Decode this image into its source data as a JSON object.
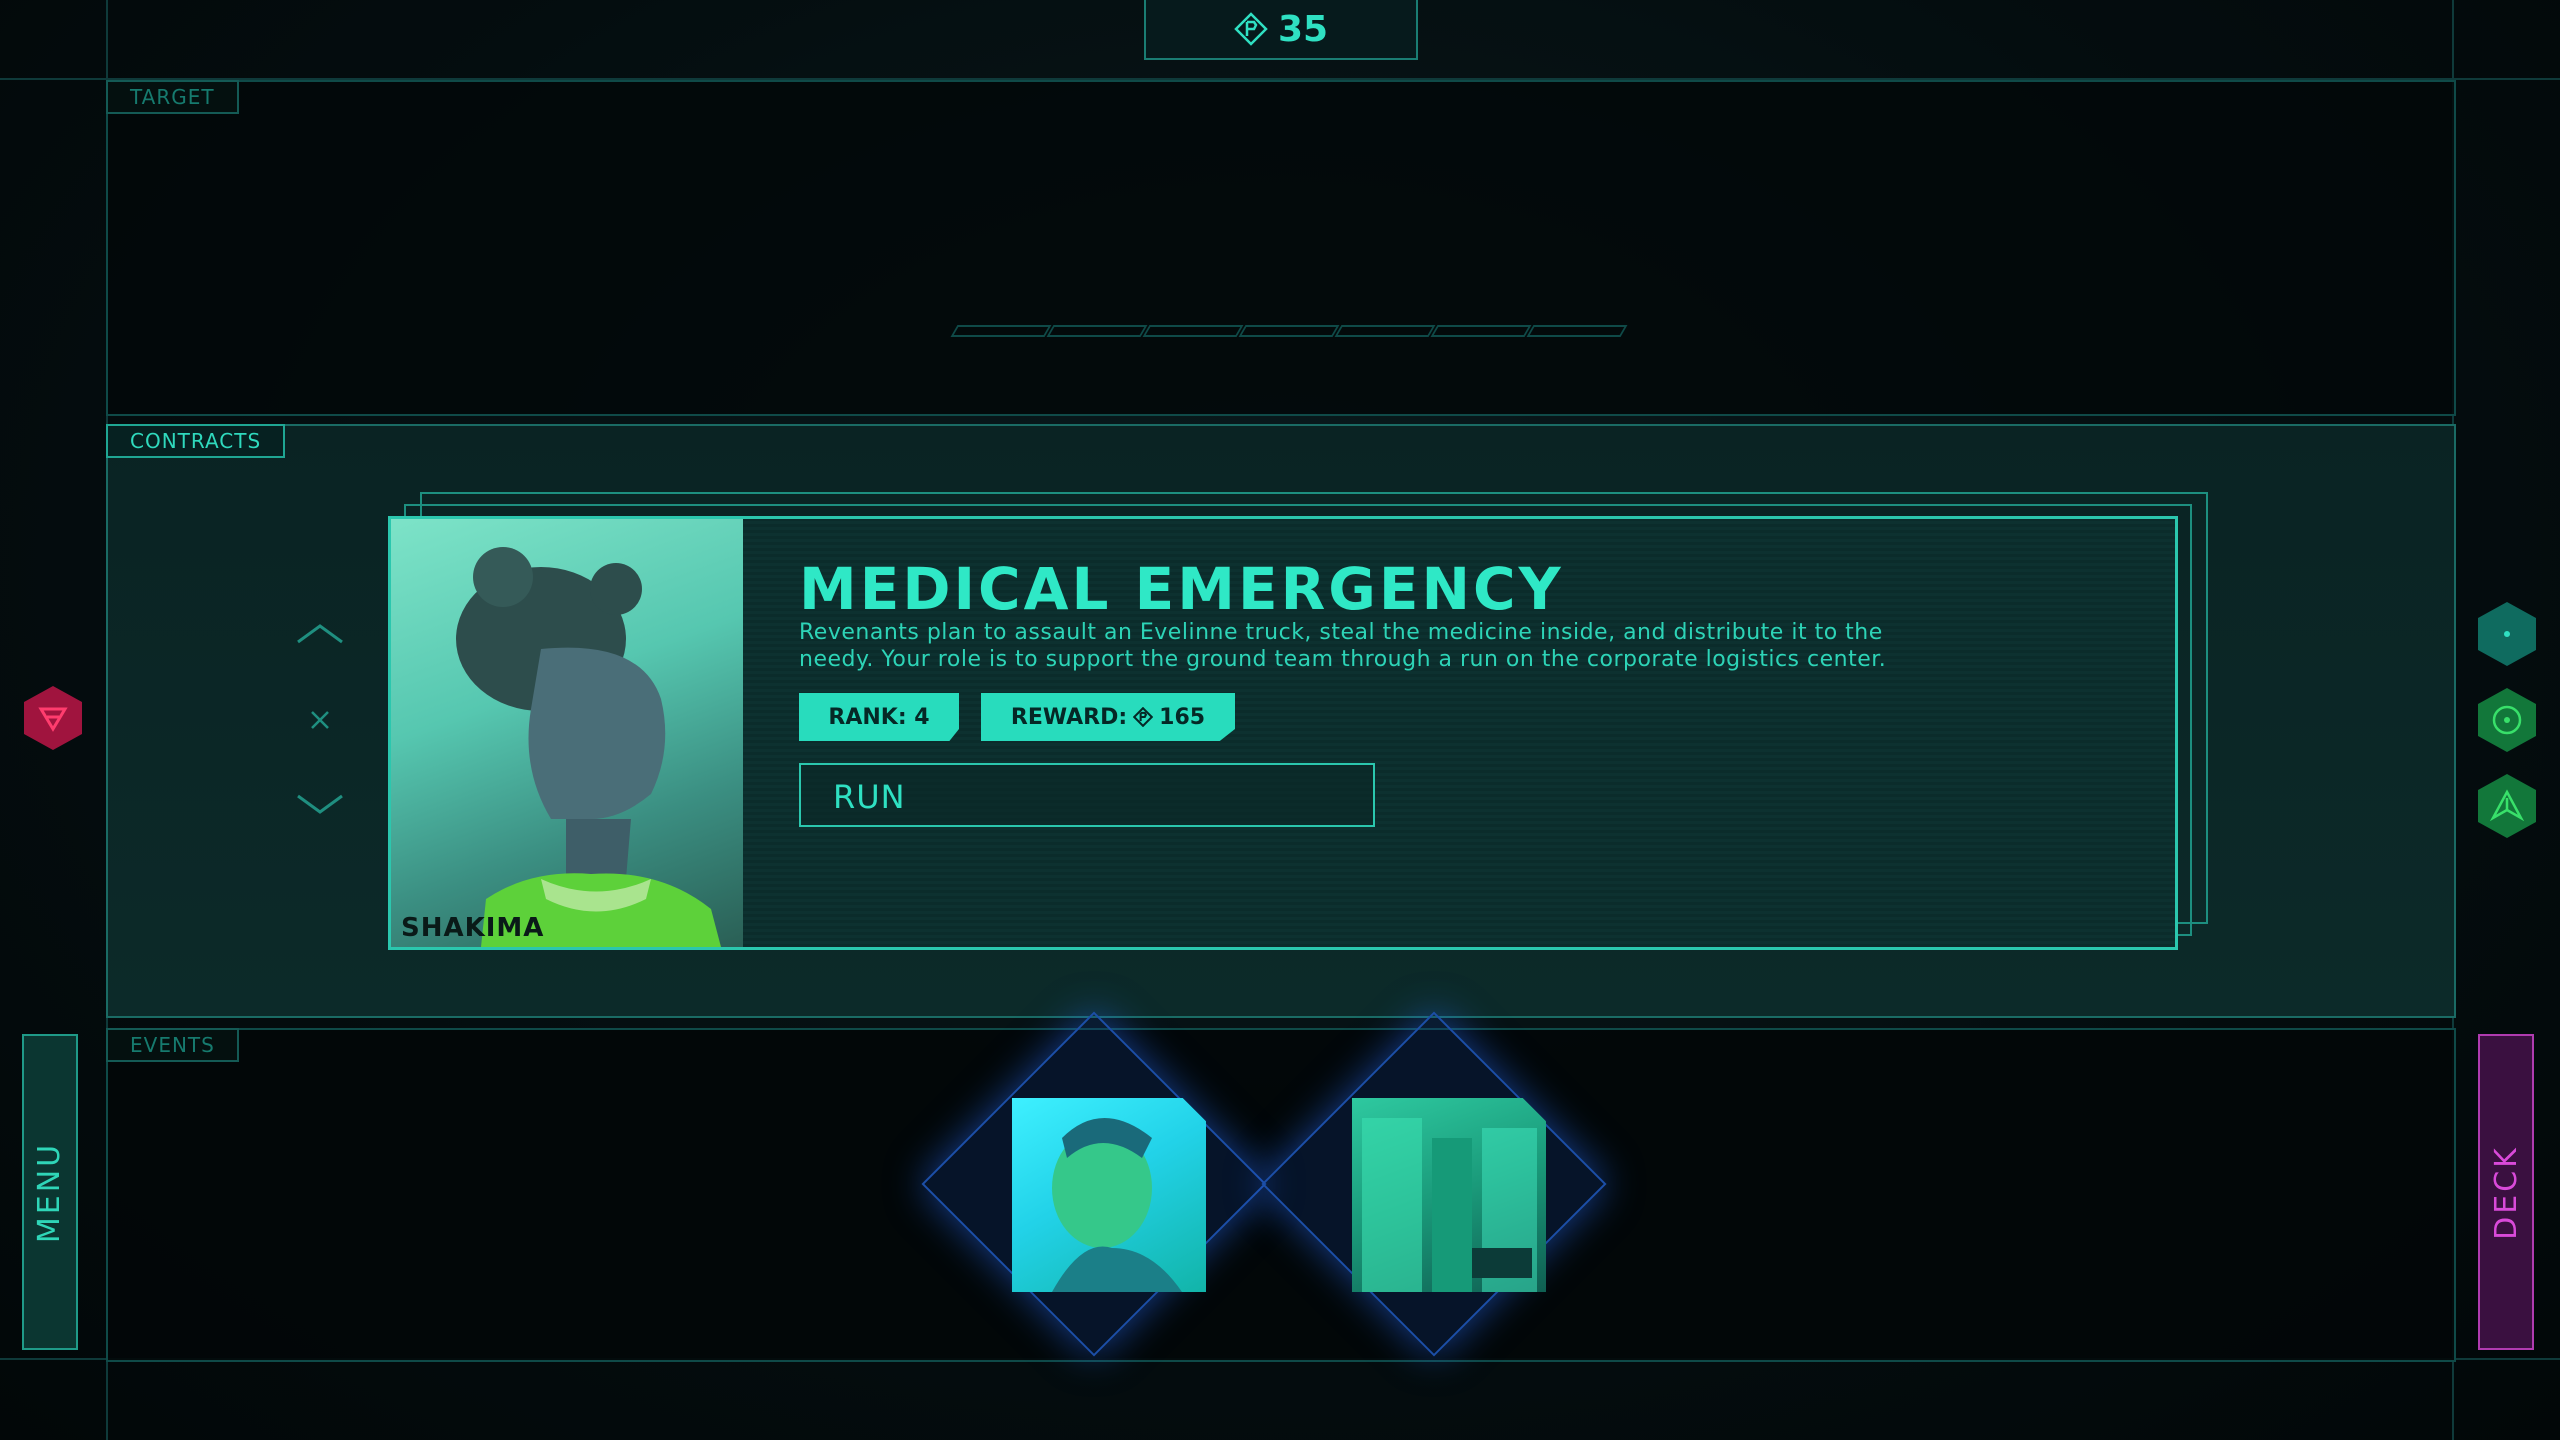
{
  "credits": {
    "icon": "credit-diamond-icon",
    "value": "35"
  },
  "target": {
    "tab_label": "TARGET"
  },
  "contracts": {
    "tab_label": "CONTRACTS",
    "card": {
      "title": "MEDICAL EMERGENCY",
      "description": "Revenants plan to assault an Evelinne truck, steal the medicine inside, and distribute it to the needy. Your role is to support the ground team through a run on the corporate logistics center.",
      "rank_label": "RANK: 4",
      "reward_label": "REWARD:",
      "reward_value": "165",
      "run_label": "RUN",
      "portrait_name": "SHAKIMA"
    }
  },
  "events": {
    "tab_label": "EVENTS"
  },
  "side": {
    "menu_label": "MENU",
    "deck_label": "DECK"
  },
  "colors": {
    "accent": "#2fe0c2",
    "panel_border": "#1a6b64",
    "deck_accent": "#d94ad9",
    "faction_red": "#c0184a",
    "faction_green": "#1faa5a"
  },
  "left_faction_icon": "red-faction-hex-icon",
  "right_icons": [
    "teal-dot-hex-icon",
    "green-target-hex-icon",
    "green-arrow-hex-icon"
  ]
}
